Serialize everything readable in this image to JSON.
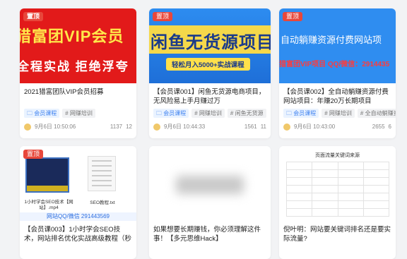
{
  "pin_label": "置顶",
  "cards": [
    {
      "thumb": {
        "line1": "猎富团VIP会员",
        "line2": "全程实战   拒绝浮夸"
      },
      "title": "2021猎富团队VIP会员招募",
      "tags": [
        "会员课程",
        "# 网赚培训"
      ],
      "date": "9月6日 10:50:06",
      "views": "1137",
      "comments": "12"
    },
    {
      "thumb": {
        "line1": "闲鱼无货源项目",
        "line2": "轻松月入5000+实战课程"
      },
      "title": "【会员课001】闲鱼无货源电商项目，无风险易上手月赚过万",
      "tags": [
        "会员课程",
        "# 网赚培训",
        "# 闲鱼无货源"
      ],
      "date": "9月6日 10:44:33",
      "views": "1561",
      "comments": "11"
    },
    {
      "thumb": {
        "line1": "自动躺赚资源付费网站项",
        "line2": "猎富团VIP项目  QQ/微信：2914435"
      },
      "title": "【会员课002】全自动躺赚资源付费网站项目：年赚20万长期项目",
      "tags": [
        "会员课程",
        "# 网赚培训",
        "# 全自动躺赚资源"
      ],
      "date": "9月6日 10:43:00",
      "views": "2655",
      "comments": "6"
    },
    {
      "thumb": {
        "caption1": "1小时学会SEO技术【网站】.mp4",
        "caption2": "SEO教程.txt",
        "qq": "网站QQ/微信 291443569"
      },
      "title": "【会员课003】1小时学会SEO技术，网站排名优化实战高级教程（秒杀市面..."
    },
    {
      "title": "如果想要长期赚钱，你必须理解这件事！【多元思维Hack】"
    },
    {
      "thumb": {
        "table_title": "页面流量关键词来源"
      },
      "title": "倪叶明：网站要关键词排名还是要实际流量?"
    }
  ]
}
